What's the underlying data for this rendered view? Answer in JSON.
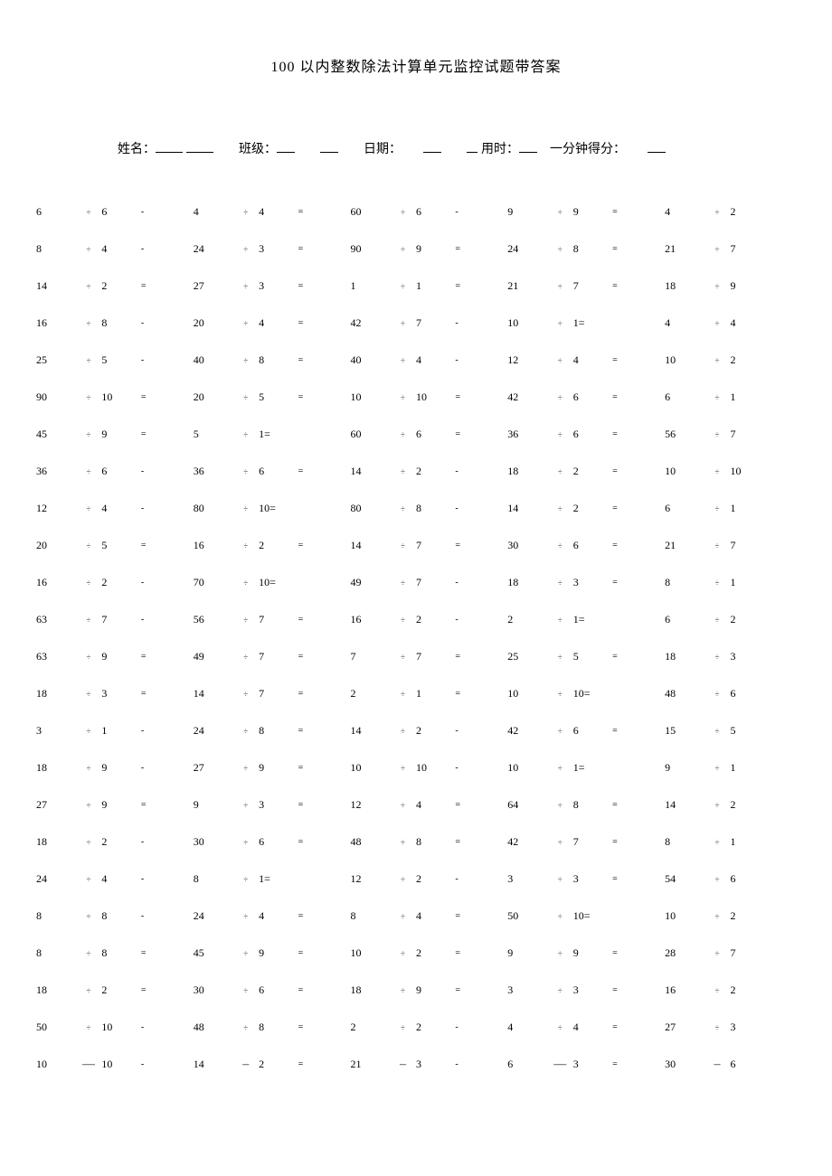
{
  "title": "100 以内整数除法计算单元监控试题带答案",
  "info": {
    "name_label": "姓名：",
    "class_label": "班级：",
    "date_label": "日期：",
    "time_label": "用时：",
    "score_label": "一分钟得分："
  },
  "problems": [
    [
      [
        "6",
        "÷",
        "6",
        "-"
      ],
      [
        "4",
        "÷",
        "4",
        "="
      ],
      [
        "60",
        "÷",
        "6",
        "-"
      ],
      [
        "9",
        "÷",
        "9",
        "="
      ],
      [
        "4",
        "÷",
        "2",
        ""
      ]
    ],
    [
      [
        "8",
        "÷",
        "4",
        "-"
      ],
      [
        "24",
        "÷",
        "3",
        "="
      ],
      [
        "90",
        "÷",
        "9",
        "="
      ],
      [
        "24",
        "÷",
        "8",
        "="
      ],
      [
        "21",
        "÷",
        "7",
        ""
      ]
    ],
    [
      [
        "14",
        "÷",
        "2",
        "="
      ],
      [
        "27",
        "÷",
        "3",
        "="
      ],
      [
        "1",
        "÷",
        "1",
        "="
      ],
      [
        "21",
        "÷",
        "7",
        "="
      ],
      [
        "18",
        "÷",
        "9",
        ""
      ]
    ],
    [
      [
        "16",
        "÷",
        "8",
        "-"
      ],
      [
        "20",
        "÷",
        "4",
        "="
      ],
      [
        "42",
        "÷",
        "7",
        "-"
      ],
      [
        "10",
        "÷",
        "1=",
        ""
      ],
      [
        "4",
        "÷",
        "4",
        ""
      ]
    ],
    [
      [
        "25",
        "÷",
        "5",
        "-"
      ],
      [
        "40",
        "÷",
        "8",
        "="
      ],
      [
        "40",
        "÷",
        "4",
        "-"
      ],
      [
        "12",
        "÷",
        "4",
        "="
      ],
      [
        "10",
        "÷",
        "2",
        ""
      ]
    ],
    [
      [
        "90",
        "÷",
        "10",
        "="
      ],
      [
        "20",
        "÷",
        "5",
        "="
      ],
      [
        "10",
        "÷",
        "10",
        "="
      ],
      [
        "42",
        "÷",
        "6",
        "="
      ],
      [
        "6",
        "÷",
        "1",
        ""
      ]
    ],
    [
      [
        "45",
        "÷",
        "9",
        "="
      ],
      [
        "5",
        "÷",
        "1=",
        ""
      ],
      [
        "60",
        "÷",
        "6",
        "="
      ],
      [
        "36",
        "÷",
        "6",
        "="
      ],
      [
        "56",
        "÷",
        "7",
        ""
      ]
    ],
    [
      [
        "36",
        "÷",
        "6",
        "-"
      ],
      [
        "36",
        "÷",
        "6",
        "="
      ],
      [
        "14",
        "÷",
        "2",
        "-"
      ],
      [
        "18",
        "÷",
        "2",
        "="
      ],
      [
        "10",
        "÷",
        "10",
        ""
      ]
    ],
    [
      [
        "12",
        "÷",
        "4",
        "-"
      ],
      [
        "80",
        "÷",
        "10=",
        ""
      ],
      [
        "80",
        "÷",
        "8",
        "-"
      ],
      [
        "14",
        "÷",
        "2",
        "="
      ],
      [
        "6",
        "÷",
        "1",
        ""
      ]
    ],
    [
      [
        "20",
        "÷",
        "5",
        "="
      ],
      [
        "16",
        "÷",
        "2",
        "="
      ],
      [
        "14",
        "÷",
        "7",
        "="
      ],
      [
        "30",
        "÷",
        "6",
        "="
      ],
      [
        "21",
        "÷",
        "7",
        ""
      ]
    ],
    [
      [
        "16",
        "÷",
        "2",
        "-"
      ],
      [
        "70",
        "÷",
        "10=",
        ""
      ],
      [
        "49",
        "÷",
        "7",
        "-"
      ],
      [
        "18",
        "÷",
        "3",
        "="
      ],
      [
        "8",
        "÷",
        "1",
        ""
      ]
    ],
    [
      [
        "63",
        "÷",
        "7",
        "-"
      ],
      [
        "56",
        "÷",
        "7",
        "="
      ],
      [
        "16",
        "÷",
        "2",
        "-"
      ],
      [
        "2",
        "÷",
        "1=",
        ""
      ],
      [
        "6",
        "÷",
        "2",
        ""
      ]
    ],
    [
      [
        "63",
        "÷",
        "9",
        "="
      ],
      [
        "49",
        "÷",
        "7",
        "="
      ],
      [
        "7",
        "÷",
        "7",
        "="
      ],
      [
        "25",
        "÷",
        "5",
        "="
      ],
      [
        "18",
        "÷",
        "3",
        ""
      ]
    ],
    [
      [
        "18",
        "÷",
        "3",
        "="
      ],
      [
        "14",
        "÷",
        "7",
        "="
      ],
      [
        "2",
        "÷",
        "1",
        "="
      ],
      [
        "10",
        "÷",
        "10=",
        ""
      ],
      [
        "48",
        "÷",
        "6",
        ""
      ]
    ],
    [
      [
        "3",
        "÷",
        "1",
        "-"
      ],
      [
        "24",
        "÷",
        "8",
        "="
      ],
      [
        "14",
        "÷",
        "2",
        "-"
      ],
      [
        "42",
        "÷",
        "6",
        "="
      ],
      [
        "15",
        "÷",
        "5",
        ""
      ]
    ],
    [
      [
        "18",
        "÷",
        "9",
        "-"
      ],
      [
        "27",
        "÷",
        "9",
        "="
      ],
      [
        "10",
        "÷",
        "10",
        "-"
      ],
      [
        "10",
        "÷",
        "1=",
        ""
      ],
      [
        "9",
        "÷",
        "1",
        ""
      ]
    ],
    [
      [
        "27",
        "÷",
        "9",
        "="
      ],
      [
        "9",
        "÷",
        "3",
        "="
      ],
      [
        "12",
        "÷",
        "4",
        "="
      ],
      [
        "64",
        "÷",
        "8",
        "="
      ],
      [
        "14",
        "÷",
        "2",
        ""
      ]
    ],
    [
      [
        "18",
        "÷",
        "2",
        "-"
      ],
      [
        "30",
        "÷",
        "6",
        "="
      ],
      [
        "48",
        "÷",
        "8",
        "="
      ],
      [
        "42",
        "÷",
        "7",
        "="
      ],
      [
        "8",
        "÷",
        "1",
        ""
      ]
    ],
    [
      [
        "24",
        "÷",
        "4",
        "-"
      ],
      [
        "8",
        "÷",
        "1=",
        ""
      ],
      [
        "12",
        "÷",
        "2",
        "-"
      ],
      [
        "3",
        "÷",
        "3",
        "="
      ],
      [
        "54",
        "÷",
        "6",
        ""
      ]
    ],
    [
      [
        "8",
        "÷",
        "8",
        "-"
      ],
      [
        "24",
        "÷",
        "4",
        "="
      ],
      [
        "8",
        "÷",
        "4",
        "="
      ],
      [
        "50",
        "÷",
        "10=",
        ""
      ],
      [
        "10",
        "÷",
        "2",
        ""
      ]
    ],
    [
      [
        "8",
        "÷",
        "8",
        "="
      ],
      [
        "45",
        "÷",
        "9",
        "="
      ],
      [
        "10",
        "÷",
        "2",
        "="
      ],
      [
        "9",
        "÷",
        "9",
        "="
      ],
      [
        "28",
        "÷",
        "7",
        ""
      ]
    ],
    [
      [
        "18",
        "÷",
        "2",
        "="
      ],
      [
        "30",
        "÷",
        "6",
        "="
      ],
      [
        "18",
        "÷",
        "9",
        "="
      ],
      [
        "3",
        "÷",
        "3",
        "="
      ],
      [
        "16",
        "÷",
        "2",
        ""
      ]
    ],
    [
      [
        "50",
        "÷",
        "10",
        "-"
      ],
      [
        "48",
        "÷",
        "8",
        "="
      ],
      [
        "2",
        "÷",
        "2",
        "-"
      ],
      [
        "4",
        "÷",
        "4",
        "="
      ],
      [
        "27",
        "÷",
        "3",
        ""
      ]
    ],
    [
      [
        "10",
        "—",
        "10",
        "-"
      ],
      [
        "14",
        "–",
        "2",
        "="
      ],
      [
        "21",
        "–",
        "3",
        "-"
      ],
      [
        "6",
        "—",
        "3",
        "="
      ],
      [
        "30",
        "–",
        "6",
        ""
      ]
    ]
  ]
}
